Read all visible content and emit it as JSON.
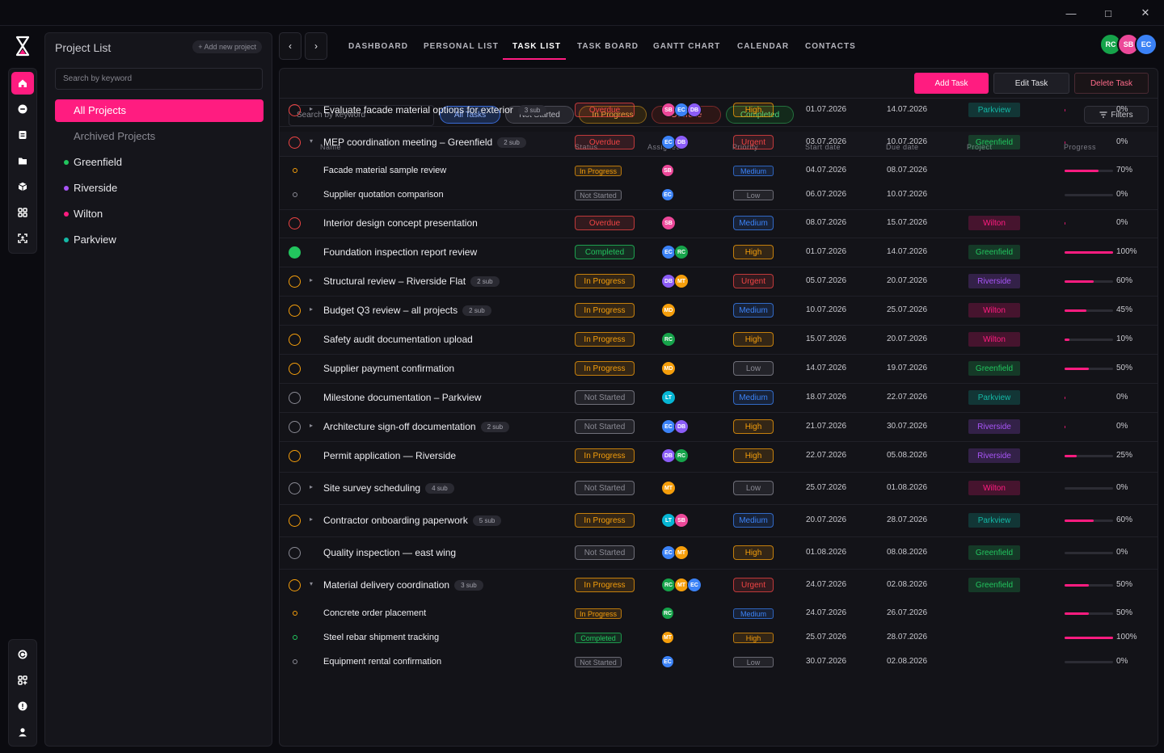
{
  "window": {
    "minimize_icon": "minimize-icon",
    "maximize_icon": "maximize-icon",
    "close_icon": "close-icon"
  },
  "rail": {
    "top_items": [
      "home-icon",
      "chat-icon",
      "document-icon",
      "folder-icon",
      "box-icon",
      "grid-icon",
      "scan-icon"
    ],
    "bottom_items": [
      "refresh-icon",
      "apps-add-icon",
      "alert-icon",
      "user-icon"
    ]
  },
  "project_list": {
    "title": "Project List",
    "add_label": "+ Add new project",
    "search_placeholder": "Search by keyword",
    "all_projects": "All Projects",
    "archived": "Archived Projects",
    "projects": [
      {
        "name": "Greenfield",
        "color": "#22c55e"
      },
      {
        "name": "Riverside",
        "color": "#a855f7"
      },
      {
        "name": "Wilton",
        "color": "#ff1c80"
      },
      {
        "name": "Parkview",
        "color": "#14b8a6"
      }
    ]
  },
  "nav": {
    "prev": "‹",
    "next": "›",
    "tabs": [
      "DASHBOARD",
      "PERSONAL LIST",
      "TASK LIST",
      "TASK BOARD",
      "GANTT CHART",
      "CALENDAR",
      "CONTACTS"
    ],
    "active_tab": "TASK LIST",
    "users": [
      {
        "initials": "RC",
        "color": "#16a34a"
      },
      {
        "initials": "SB",
        "color": "#ec4899"
      },
      {
        "initials": "EC",
        "color": "#3b82f6"
      }
    ]
  },
  "toolbar": {
    "add": "Add Task",
    "edit": "Edit Task",
    "delete": "Delete Task"
  },
  "filters": {
    "search_placeholder": "Search by keyword",
    "chips": [
      "All Tasks",
      "Not Started",
      "In Progress",
      "Overdue",
      "Completed"
    ],
    "filters_label": "Filters"
  },
  "columns": {
    "name": "Name",
    "status": "Status",
    "assignee": "Assignee",
    "priority": "Priority",
    "start": "Start date",
    "due": "Due date",
    "project": "Project",
    "progress": "Progress"
  },
  "tasks": [
    {
      "name": "Evaluate facade material options for exterior",
      "sub": "3 sub",
      "caret": "▸",
      "status": "Overdue",
      "assignees": [
        "SB",
        "EC",
        "DB"
      ],
      "priority": "High",
      "start": "01.07.2026",
      "due": "14.07.2026",
      "project": "Parkview",
      "progress": 0,
      "pct": "0%"
    },
    {
      "name": "MEP coordination meeting – Greenfield",
      "sub": "2 sub",
      "caret": "▾",
      "status": "Overdue",
      "assignees": [
        "EC",
        "DB"
      ],
      "priority": "Urgent",
      "start": "03.07.2026",
      "due": "10.07.2026",
      "project": "Greenfield",
      "progress": 0,
      "pct": "0%"
    },
    {
      "child": true,
      "name": "Facade material sample review",
      "status": "In Progress",
      "assignees": [
        "SB"
      ],
      "priority": "Medium",
      "start": "04.07.2026",
      "due": "08.07.2026",
      "project": "",
      "progress": 70,
      "pct": "70%"
    },
    {
      "child": true,
      "name": "Supplier quotation comparison",
      "status": "Not Started",
      "assignees": [
        "EC"
      ],
      "priority": "Low",
      "start": "06.07.2026",
      "due": "10.07.2026",
      "project": "",
      "progress": 0,
      "pct": "0%"
    },
    {
      "name": "Interior design concept presentation",
      "status": "Overdue",
      "assignees": [
        "SB"
      ],
      "priority": "Medium",
      "start": "08.07.2026",
      "due": "15.07.2026",
      "project": "Wilton",
      "progress": 0,
      "pct": "0%"
    },
    {
      "name": "Foundation inspection report review",
      "status": "Completed",
      "assignees": [
        "EC",
        "RC"
      ],
      "priority": "High",
      "start": "01.07.2026",
      "due": "14.07.2026",
      "project": "Greenfield",
      "progress": 100,
      "pct": "100%"
    },
    {
      "name": "Structural review – Riverside Flat",
      "sub": "2 sub",
      "caret": "▸",
      "status": "In Progress",
      "assignees": [
        "DB",
        "MT"
      ],
      "priority": "Urgent",
      "start": "05.07.2026",
      "due": "20.07.2026",
      "project": "Riverside",
      "progress": 60,
      "pct": "60%"
    },
    {
      "name": "Budget Q3 review – all projects",
      "sub": "2 sub",
      "caret": "▸",
      "status": "In Progress",
      "assignees": [
        "MD"
      ],
      "priority": "Medium",
      "start": "10.07.2026",
      "due": "25.07.2026",
      "project": "Wilton",
      "progress": 45,
      "pct": "45%"
    },
    {
      "name": "Safety audit documentation upload",
      "status": "In Progress",
      "assignees": [
        "RC"
      ],
      "priority": "High",
      "start": "15.07.2026",
      "due": "20.07.2026",
      "project": "Wilton",
      "progress": 10,
      "pct": "10%"
    },
    {
      "name": "Supplier payment confirmation",
      "status": "In Progress",
      "assignees": [
        "MD"
      ],
      "priority": "Low",
      "start": "14.07.2026",
      "due": "19.07.2026",
      "project": "Greenfield",
      "progress": 50,
      "pct": "50%"
    },
    {
      "name": "Milestone documentation – Parkview",
      "status": "Not Started",
      "assignees": [
        "LT"
      ],
      "priority": "Medium",
      "start": "18.07.2026",
      "due": "22.07.2026",
      "project": "Parkview",
      "progress": 0,
      "pct": "0%"
    },
    {
      "name": "Architecture sign-off documentation",
      "sub": "2 sub",
      "caret": "▸",
      "status": "Not Started",
      "assignees": [
        "EC",
        "DB"
      ],
      "priority": "High",
      "start": "21.07.2026",
      "due": "30.07.2026",
      "project": "Riverside",
      "progress": 0,
      "pct": "0%"
    },
    {
      "name": "Permit application — Riverside",
      "status": "In Progress",
      "assignees": [
        "DB",
        "RC"
      ],
      "priority": "High",
      "start": "22.07.2026",
      "due": "05.08.2026",
      "project": "Riverside",
      "progress": 25,
      "pct": "25%"
    },
    {
      "name": "Site survey scheduling",
      "sub": "4 sub",
      "caret": "▸",
      "status": "Not Started",
      "assignees": [
        "MT"
      ],
      "priority": "Low",
      "start": "25.07.2026",
      "due": "01.08.2026",
      "project": "Wilton",
      "progress": 0,
      "pct": "0%"
    },
    {
      "name": "Contractor onboarding paperwork",
      "sub": "5 sub",
      "caret": "▸",
      "status": "In Progress",
      "assignees": [
        "LT",
        "SB"
      ],
      "priority": "Medium",
      "start": "20.07.2026",
      "due": "28.07.2026",
      "project": "Parkview",
      "progress": 60,
      "pct": "60%"
    },
    {
      "name": "Quality inspection — east wing",
      "status": "Not Started",
      "assignees": [
        "EC",
        "MT"
      ],
      "priority": "High",
      "start": "01.08.2026",
      "due": "08.08.2026",
      "project": "Greenfield",
      "progress": 0,
      "pct": "0%"
    },
    {
      "name": "Material delivery coordination",
      "sub": "3 sub",
      "caret": "▾",
      "status": "In Progress",
      "assignees": [
        "RC",
        "MT",
        "EC"
      ],
      "priority": "Urgent",
      "start": "24.07.2026",
      "due": "02.08.2026",
      "project": "Greenfield",
      "progress": 50,
      "pct": "50%"
    },
    {
      "child": true,
      "name": "Concrete order placement",
      "status": "In Progress",
      "assignees": [
        "RC"
      ],
      "priority": "Medium",
      "start": "24.07.2026",
      "due": "26.07.2026",
      "project": "",
      "progress": 50,
      "pct": "50%"
    },
    {
      "child": true,
      "name": "Steel rebar shipment tracking",
      "status": "Completed",
      "assignees": [
        "MT"
      ],
      "priority": "High",
      "start": "25.07.2026",
      "due": "28.07.2026",
      "project": "",
      "progress": 100,
      "pct": "100%"
    },
    {
      "child": true,
      "name": "Equipment rental confirmation",
      "status": "Not Started",
      "assignees": [
        "EC"
      ],
      "priority": "Low",
      "start": "30.07.2026",
      "due": "02.08.2026",
      "project": "",
      "progress": 0,
      "pct": "0%"
    }
  ],
  "colors": {
    "accent": "#ff1c80",
    "status": {
      "Overdue": "#ef4444",
      "In Progress": "#f59e0b",
      "Completed": "#22c55e",
      "Not Started": "#8a8a94"
    },
    "priority": {
      "High": "#f59e0b",
      "Urgent": "#ef4444",
      "Medium": "#3b82f6",
      "Low": "#8a8a94"
    },
    "project": {
      "Parkview": "#14b8a6",
      "Greenfield": "#22c55e",
      "Wilton": "#ff1c80",
      "Riverside": "#a855f7"
    },
    "avatar": {
      "SB": "#ec4899",
      "EC": "#3b82f6",
      "DB": "#8b5cf6",
      "RC": "#16a34a",
      "MT": "#f59e0b",
      "MD": "#f59e0b",
      "LT": "#06b6d4"
    }
  }
}
